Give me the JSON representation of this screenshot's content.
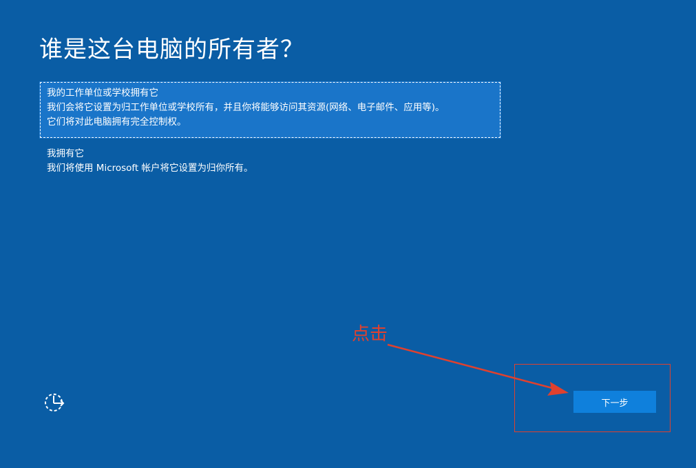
{
  "page": {
    "title": "谁是这台电脑的所有者？"
  },
  "options": [
    {
      "title": "我的工作单位或学校拥有它",
      "description_line1": "我们会将它设置为归工作单位或学校所有，并且你将能够访问其资源(网络、电子邮件、应用等)。",
      "description_line2": "它们将对此电脑拥有完全控制权。",
      "selected": true
    },
    {
      "title": "我拥有它",
      "description_line1": "我们将使用 Microsoft 帐户将它设置为归你所有。",
      "selected": false
    }
  ],
  "footer": {
    "next_label": "下一步",
    "accessibility_icon": "ease-of-access-icon"
  },
  "annotation": {
    "text": "点击",
    "color": "#e0412e"
  },
  "colors": {
    "background": "#0a5da5",
    "selected_option": "#1a75c9",
    "button": "#0f80dc"
  }
}
